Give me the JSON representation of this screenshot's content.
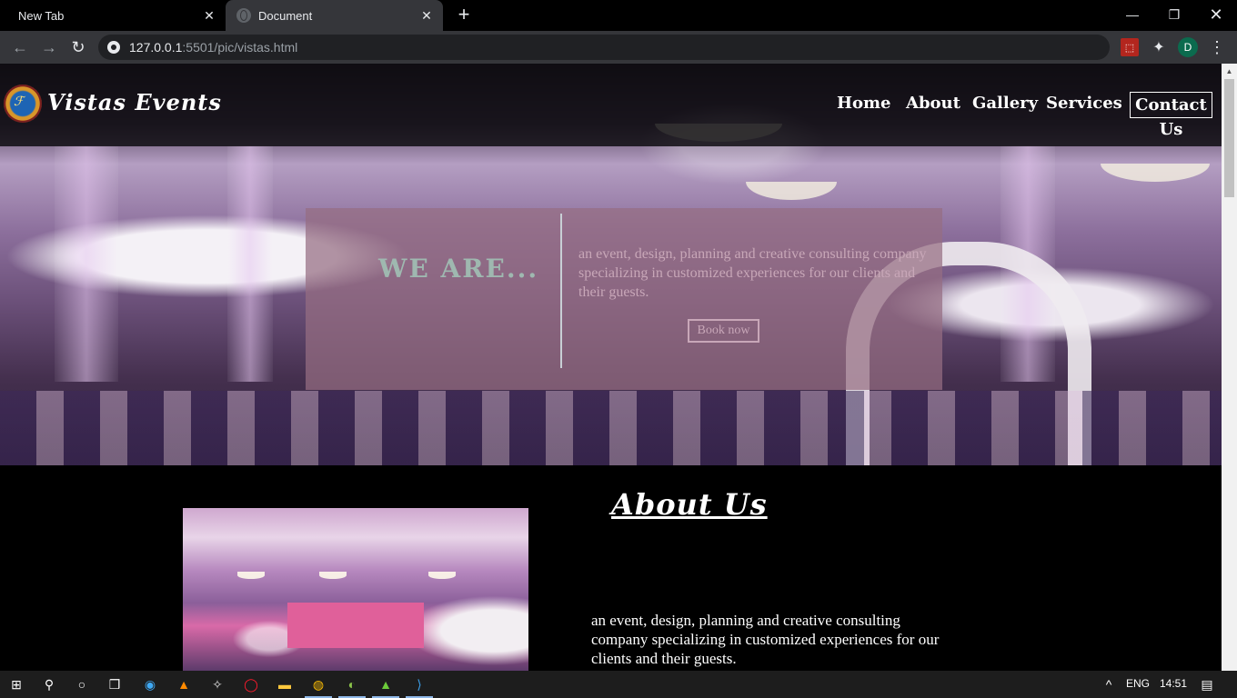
{
  "browser": {
    "tabs": [
      {
        "title": "New Tab",
        "active": false
      },
      {
        "title": "Document",
        "active": true
      }
    ],
    "url_host": "127.0.0.1",
    "url_rest": ":5501/pic/vistas.html",
    "profile_initial": "D",
    "icons": {
      "back": "arrow-left-icon",
      "forward": "arrow-right-icon",
      "reload": "reload-icon",
      "site_info": "site-info-icon",
      "pdf_extension": "pdf-extension-icon",
      "extensions": "puzzle-icon",
      "menu": "more-vertical-icon",
      "minimize": "minimize-icon",
      "restore": "restore-icon",
      "close": "close-icon",
      "new_tab": "plus-icon"
    }
  },
  "site": {
    "brand": "Vistas Events",
    "nav": [
      "Home",
      "About",
      "Gallery",
      "Services",
      "Contact Us"
    ],
    "hero": {
      "heading": "WE ARE...",
      "text": "an event, design, planning and creative consulting company specializing in customized experiences for our clients and their guests.",
      "button": "Book now"
    },
    "about": {
      "title": "About Us",
      "text": "an event, design, planning and creative consulting company specializing in customized experiences for our clients and their guests."
    }
  },
  "taskbar": {
    "language": "ENG",
    "time": "14:51"
  }
}
